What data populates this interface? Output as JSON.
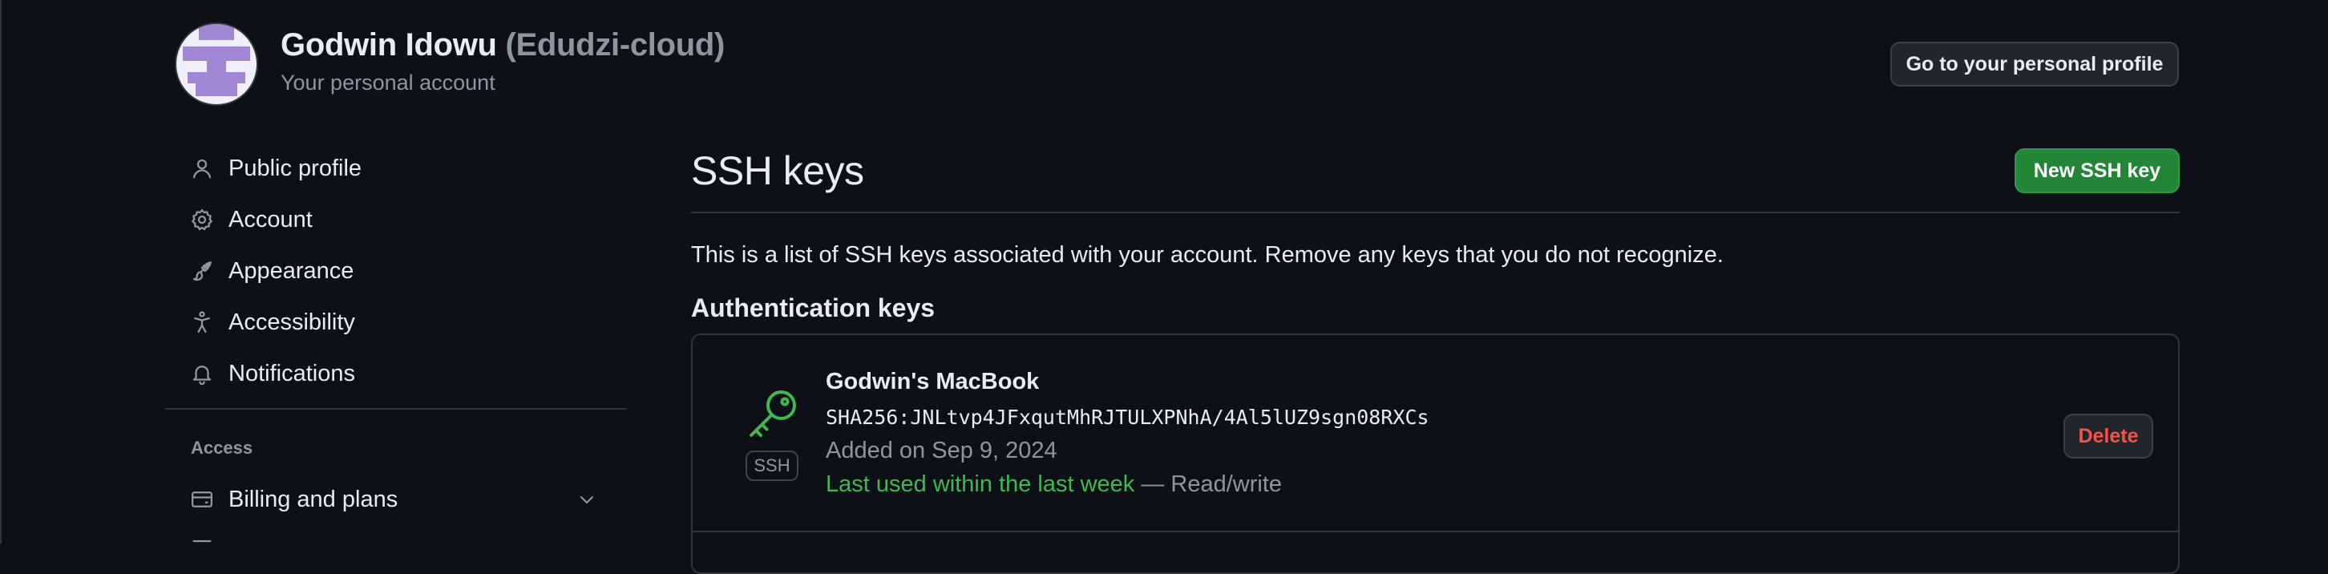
{
  "account": {
    "name": "Godwin Idowu",
    "login": "(Edudzi-cloud)",
    "subtitle": "Your personal account",
    "profile_button": "Go to your personal profile"
  },
  "sidebar": {
    "items": [
      {
        "label": "Public profile",
        "icon": "person-icon"
      },
      {
        "label": "Account",
        "icon": "gear-icon"
      },
      {
        "label": "Appearance",
        "icon": "paintbrush-icon"
      },
      {
        "label": "Accessibility",
        "icon": "accessibility-icon"
      },
      {
        "label": "Notifications",
        "icon": "bell-icon"
      }
    ],
    "section_access": "Access",
    "access_items": [
      {
        "label": "Billing and plans",
        "icon": "credit-card-icon"
      }
    ]
  },
  "main": {
    "title": "SSH keys",
    "new_button": "New SSH key",
    "description": "This is a list of SSH keys associated with your account. Remove any keys that you do not recognize.",
    "section": "Authentication keys",
    "keys": [
      {
        "title": "Godwin's MacBook",
        "fingerprint": "SHA256:JNLtvp4JFxqutMhRJTULXPNhA/4Al5lUZ9sgn08RXCs",
        "added": "Added on Sep 9, 2024",
        "last_used": "Last used within the last week",
        "access": " — Read/write",
        "badge": "SSH",
        "delete_label": "Delete"
      }
    ]
  },
  "colors": {
    "background": "#0d1117",
    "accent_green": "#3fb950",
    "button_green": "#238636",
    "danger": "#f85149"
  }
}
